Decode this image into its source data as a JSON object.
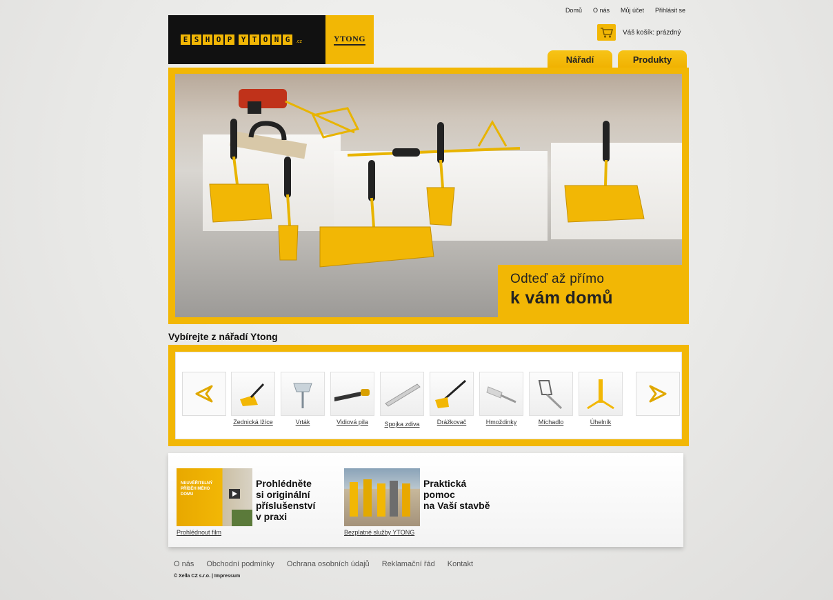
{
  "top_nav": [
    "Domů",
    "O nás",
    "Můj účet",
    "Přihlásit se"
  ],
  "logo": {
    "eshop_letters": [
      "E",
      "S",
      "H",
      "O",
      "P"
    ],
    "ytong_letters": [
      "Y",
      "T",
      "O",
      "N",
      "G"
    ],
    "cz": ".cz",
    "ytong_brand": "YTONG"
  },
  "cart": {
    "text": "Váš košík: prázdný",
    "icon": "cart-icon"
  },
  "tabs": [
    "Nářadí",
    "Produkty"
  ],
  "hero": {
    "caption_line1": "Odteď až přímo",
    "caption_line2": "k vám domů"
  },
  "section_title": "Vybírejte z nářadí Ytong",
  "products": [
    {
      "label": "Zednická lžíce",
      "icon": "trowel-icon"
    },
    {
      "label": "Vrták",
      "icon": "drill-bit-icon"
    },
    {
      "label": "Vidiová pila",
      "icon": "saw-icon"
    },
    {
      "label": "Spojka zdiva",
      "icon": "wall-tie-icon"
    },
    {
      "label": "Drážkovač",
      "icon": "groover-icon"
    },
    {
      "label": "Hmoždinky",
      "icon": "dowel-icon"
    },
    {
      "label": "Míchadlo",
      "icon": "mixer-icon"
    },
    {
      "label": "Úhelník",
      "icon": "square-icon"
    }
  ],
  "promo": [
    {
      "thumb_text": "NEUVĚŘITELNÝ PŘÍBĚH MÉHO DOMU",
      "heading": [
        "Prohlédněte",
        "si originální",
        "příslušenství",
        "v praxi"
      ],
      "link": "Prohlédnout film"
    },
    {
      "heading": [
        "Praktická",
        "pomoc",
        "na Vaší stavbě"
      ],
      "link": "Bezplatné služby YTONG"
    }
  ],
  "footer_links": [
    "O nás",
    "Obchodní podmínky",
    "Ochrana osobních údajů",
    "Reklamační řád",
    "Kontakt"
  ],
  "copyright": "© Xella CZ s.r.o. | Impressum",
  "colors": {
    "brand_yellow": "#f2b705",
    "logo_black": "#111111"
  }
}
